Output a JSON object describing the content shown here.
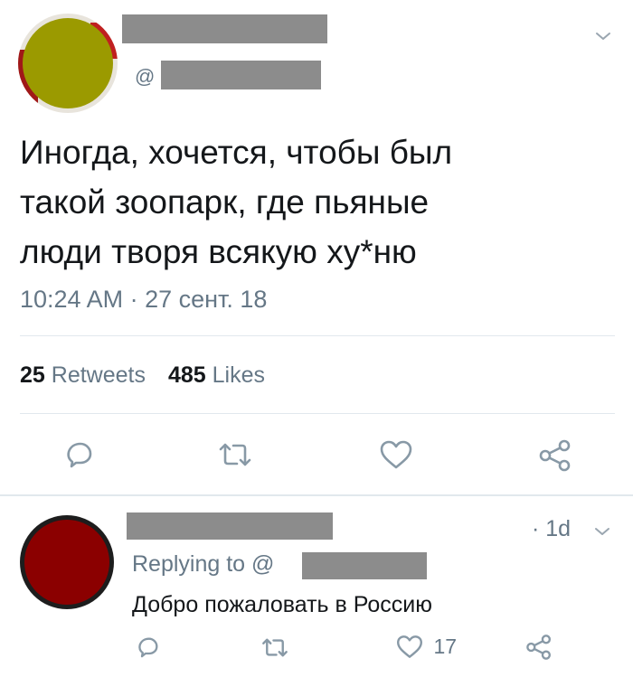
{
  "main_tweet": {
    "handle_prefix": "@",
    "text_lines": [
      "Иногда, хочется, чтобы был",
      "такой зоопарк, где пьяные",
      "люди творя всякую ху*ню"
    ],
    "timestamp": "10:24 AM · 27 сент. 18",
    "retweets_count": "25",
    "retweets_label": "Retweets",
    "likes_count": "485",
    "likes_label": "Likes",
    "avatar_color": "#9b9a00"
  },
  "reply": {
    "time": "· 1d",
    "replying_label": "Replying to",
    "replying_handle_prefix": "@",
    "text": "Добро пожаловать в Россию",
    "like_count": "17",
    "avatar_color": "#8b0000"
  },
  "icons": {
    "chevron": "chevron-down-icon",
    "reply": "reply-icon",
    "retweet": "retweet-icon",
    "like": "heart-icon",
    "share": "share-icon"
  },
  "colors": {
    "text": "#14171a",
    "secondary": "#657786",
    "divider": "#e1e8ed",
    "redaction": "#8c8c8c"
  }
}
